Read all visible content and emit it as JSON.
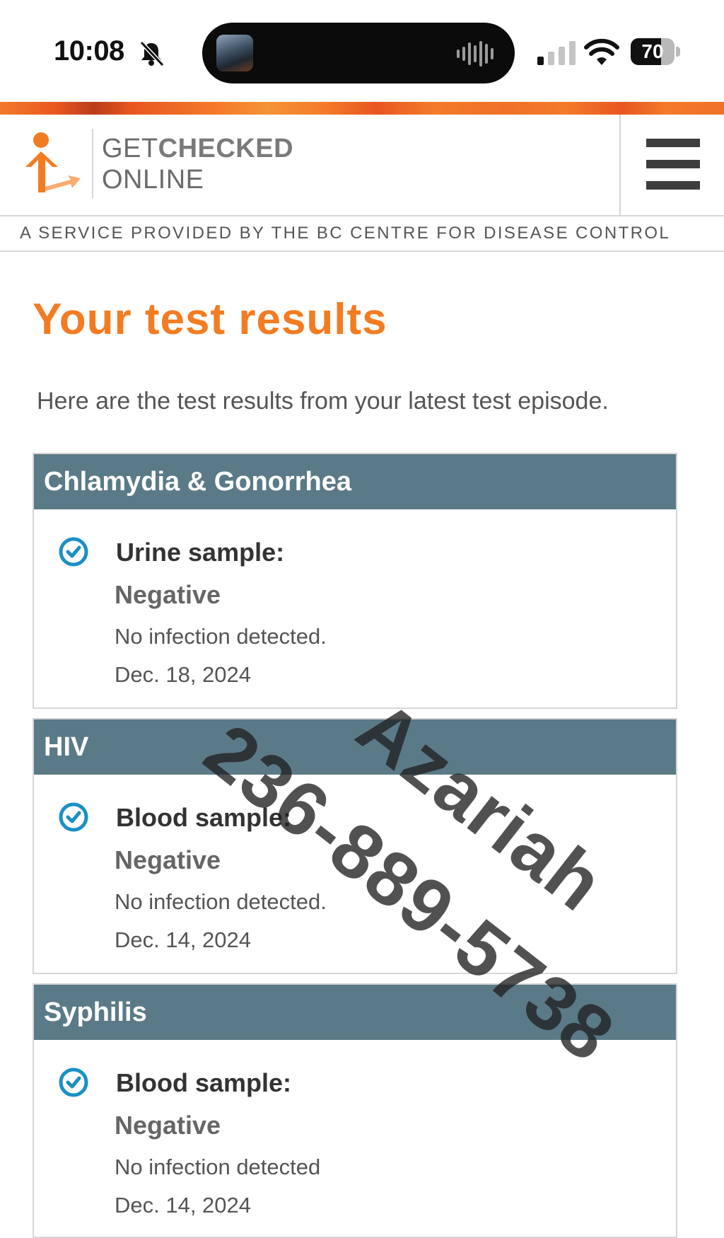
{
  "status_bar": {
    "time": "10:08",
    "battery": "70",
    "battery_level": 0.7,
    "signal_bars_active": 1,
    "icons": [
      "bell-slash-icon",
      "cellular-signal-icon",
      "wifi-icon",
      "battery-icon",
      "audio-waveform-icon"
    ]
  },
  "header": {
    "logo_line1_regular": "GET",
    "logo_line1_bold": "CHECKED",
    "logo_line2": "ONLINE",
    "tagline": "A SERVICE PROVIDED BY THE BC CENTRE FOR DISEASE CONTROL",
    "menu_icon": "hamburger-menu-icon",
    "accent_color": "#f37c22"
  },
  "page": {
    "title": "Your test results",
    "intro": "Here are the test results from your latest test episode."
  },
  "results": [
    {
      "title": "Chlamydia & Gonorrhea",
      "sample": "Urine sample:",
      "result": "Negative",
      "detail": "No infection detected.",
      "date": "Dec. 18, 2024",
      "icon": "check-circle-icon"
    },
    {
      "title": "HIV",
      "sample": "Blood sample:",
      "result": "Negative",
      "detail": "No infection detected.",
      "date": "Dec. 14, 2024",
      "icon": "check-circle-icon"
    },
    {
      "title": "Syphilis",
      "sample": "Blood sample:",
      "result": "Negative",
      "detail": "No infection detected",
      "date": "Dec. 14, 2024",
      "icon": "check-circle-icon"
    }
  ],
  "colors": {
    "card_header": "#5b7a87",
    "check_icon": "#1a8fc4"
  },
  "watermark": {
    "name": "Azariah",
    "phone": "236-889-5738"
  }
}
